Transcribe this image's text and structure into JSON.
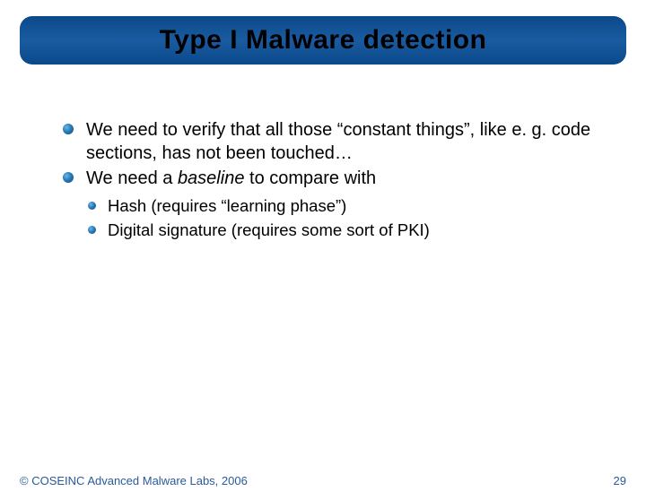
{
  "title": "Type I Malware detection",
  "bullets": [
    {
      "text": "We need to verify that all those “constant things”, like e. g. code sections, has not been touched…"
    },
    {
      "prefix": "We need a ",
      "italic": "baseline",
      "suffix": " to compare with"
    }
  ],
  "subbullets": [
    "Hash (requires “learning phase”)",
    "Digital signature (requires some sort of PKI)"
  ],
  "footer": {
    "copyright": "© COSEINC Advanced Malware Labs, 2006",
    "page": "29"
  }
}
